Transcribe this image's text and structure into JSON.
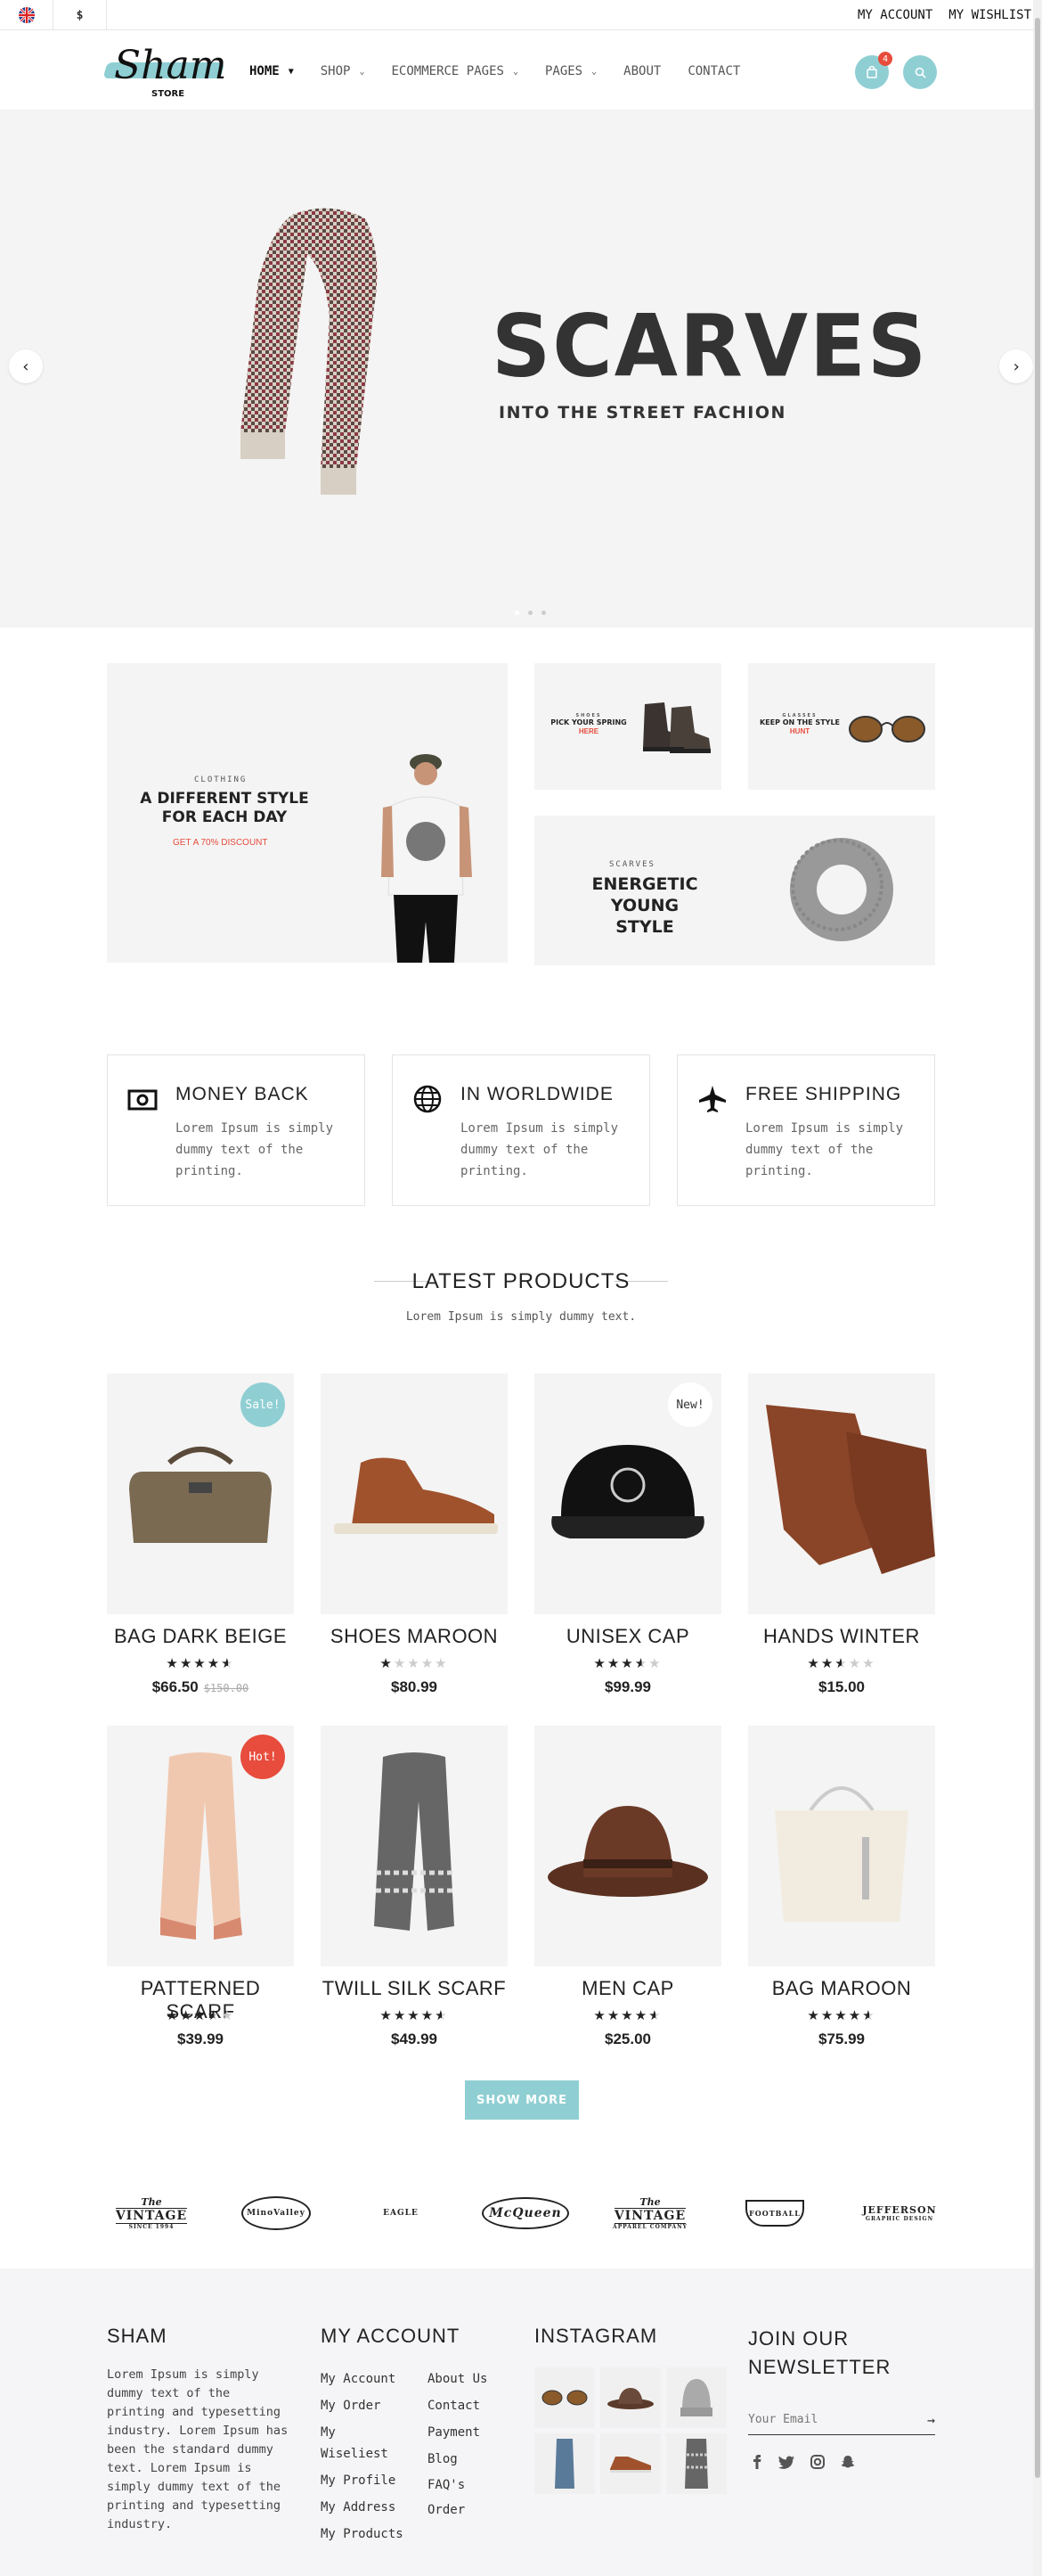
{
  "topbar": {
    "currency": "$",
    "my_account": "MY ACCOUNT",
    "my_wishlist": "MY WISHLIST",
    "flag_icon": "uk-flag-icon"
  },
  "header": {
    "logo_text": "Sham",
    "logo_sub": "STORE",
    "nav": [
      {
        "label": "HOME",
        "dropdown": true
      },
      {
        "label": "SHOP",
        "dropdown": true
      },
      {
        "label": "ECOMMERCE PAGES",
        "dropdown": true
      },
      {
        "label": "PAGES",
        "dropdown": true
      },
      {
        "label": "ABOUT",
        "dropdown": false
      },
      {
        "label": "CONTACT",
        "dropdown": false
      }
    ],
    "cart_count": "4",
    "accent": "#8fcfd3"
  },
  "hero": {
    "title": "SCARVES",
    "subtitle": "INTO THE STREET FACHION",
    "prev": "‹",
    "next": "›"
  },
  "banners": {
    "clothing": {
      "label": "CLOTHING",
      "title_line1": "A DIFFERENT STYLE",
      "title_line2": "FOR EACH DAY",
      "discount": "GET A 70% DISCOUNT"
    },
    "shoes": {
      "label": "SHOES",
      "title": "PICK YOUR SPRING",
      "highlight": "HERE"
    },
    "glasses": {
      "label": "GLASSES",
      "title": "KEEP ON THE STYLE",
      "highlight": "HUNT"
    },
    "scarves": {
      "label": "SCARVES",
      "title_line1": "ENERGETIC YOUNG",
      "title_line2": "STYLE"
    }
  },
  "features": [
    {
      "title": "MONEY BACK",
      "text": "Lorem Ipsum is simply dummy text of the printing.",
      "icon": "money-icon"
    },
    {
      "title": "IN WORLDWIDE",
      "text": "Lorem Ipsum is simply dummy text of the printing.",
      "icon": "globe-icon"
    },
    {
      "title": "FREE SHIPPING",
      "text": "Lorem Ipsum is simply dummy text of the printing.",
      "icon": "plane-icon"
    }
  ],
  "latest": {
    "title": "LATEST PRODUCTS",
    "subtitle": "Lorem Ipsum is simply dummy text.",
    "show_more": "SHOW MORE",
    "products": [
      {
        "name": "BAG DARK BEIGE",
        "rating": 4.5,
        "price": "$66.50",
        "old_price": "$150.00",
        "tag": "Sale!"
      },
      {
        "name": "SHOES MAROON",
        "rating": 1,
        "price": "$80.99",
        "old_price": "",
        "tag": ""
      },
      {
        "name": "UNISEX CAP",
        "rating": 3.5,
        "price": "$99.99",
        "old_price": "",
        "tag": "New!"
      },
      {
        "name": "HANDS WINTER",
        "rating": 2.5,
        "price": "$15.00",
        "old_price": "",
        "tag": ""
      },
      {
        "name": "PATTERNED SCARF",
        "rating": 3.5,
        "price": "$39.99",
        "old_price": "",
        "tag": "Hot!"
      },
      {
        "name": "TWILL SILK SCARF",
        "rating": 4.5,
        "price": "$49.99",
        "old_price": "",
        "tag": ""
      },
      {
        "name": "MEN CAP",
        "rating": 4.5,
        "price": "$25.00",
        "old_price": "",
        "tag": ""
      },
      {
        "name": "BAG MAROON",
        "rating": 4.5,
        "price": "$75.99",
        "old_price": "",
        "tag": ""
      }
    ]
  },
  "brands": [
    {
      "line1": "The",
      "line2": "VINTAGE",
      "line3": "SINCE 1994"
    },
    {
      "line1": "",
      "line2": "MinoValley",
      "line3": ""
    },
    {
      "line1": "",
      "line2": "EAGLE",
      "line3": ""
    },
    {
      "line1": "",
      "line2": "McQueen",
      "line3": ""
    },
    {
      "line1": "The",
      "line2": "VINTAGE",
      "line3": "APPAREL COMPANY"
    },
    {
      "line1": "",
      "line2": "FOOTBALL",
      "line3": ""
    },
    {
      "line1": "",
      "line2": "JEFFERSON",
      "line3": "GRAPHIC DESIGN"
    }
  ],
  "footer": {
    "about_title": "SHAM",
    "about_text": "Lorem Ipsum is simply dummy text of the printing and typesetting industry. Lorem Ipsum has been the standard dummy text. Lorem Ipsum is simply dummy text of the printing and typesetting industry.",
    "account_title": "MY ACCOUNT",
    "account_links_1": [
      "My Account",
      "My Order",
      "My Wiseliest",
      "My Profile",
      "My Address",
      "My Products"
    ],
    "account_links_2": [
      "About Us",
      "Contact",
      "Payment",
      "Blog",
      "FAQ's Order"
    ],
    "instagram_title": "INSTAGRAM",
    "newsletter_title_1": "JOIN OUR",
    "newsletter_title_2": "NEWSLETTER",
    "email_placeholder": "Your Email",
    "social": [
      "facebook-icon",
      "twitter-icon",
      "instagram-icon",
      "snapchat-icon"
    ]
  }
}
